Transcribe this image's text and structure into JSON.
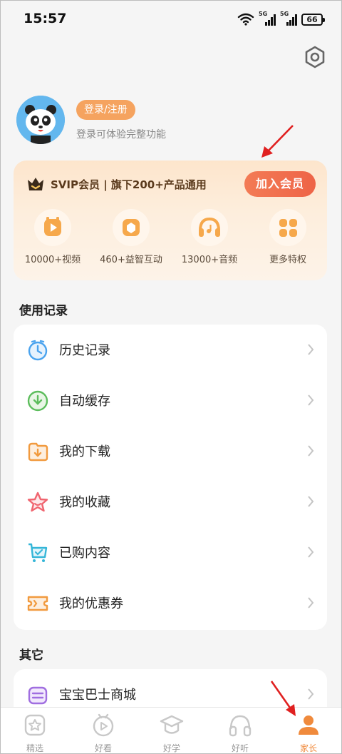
{
  "status_bar": {
    "time": "15:57",
    "network_1": "5G",
    "network_2": "5G",
    "battery": "66"
  },
  "profile": {
    "login_label": "登录/注册",
    "hint": "登录可体验完整功能"
  },
  "vip": {
    "title": "SVIP会员 | 旗下200+产品通用",
    "join_label": "加入会员",
    "perks": [
      {
        "label": "10000+视频",
        "icon": "video-icon"
      },
      {
        "label": "460+益智互动",
        "icon": "puzzle-icon"
      },
      {
        "label": "13000+音频",
        "icon": "headphones-icon"
      },
      {
        "label": "更多特权",
        "icon": "grid-icon"
      }
    ]
  },
  "usage": {
    "title": "使用记录",
    "items": [
      {
        "label": "历史记录",
        "icon": "clock-icon",
        "color": "#4aa3ee"
      },
      {
        "label": "自动缓存",
        "icon": "cache-icon",
        "color": "#5cbd5c"
      },
      {
        "label": "我的下载",
        "icon": "download-icon",
        "color": "#f19a3e"
      },
      {
        "label": "我的收藏",
        "icon": "star-icon",
        "color": "#f0646f"
      },
      {
        "label": "已购内容",
        "icon": "cart-icon",
        "color": "#34b6d8"
      },
      {
        "label": "我的优惠券",
        "icon": "coupon-icon",
        "color": "#f19a3e"
      }
    ]
  },
  "other": {
    "title": "其它",
    "items": [
      {
        "label": "宝宝巴士商城",
        "icon": "shop-icon",
        "color": "#a06ee0"
      }
    ]
  },
  "tabbar": {
    "items": [
      {
        "label": "精选",
        "icon": "star-badge-icon",
        "active": false
      },
      {
        "label": "好看",
        "icon": "tv-icon",
        "active": false
      },
      {
        "label": "好学",
        "icon": "cap-icon",
        "active": false
      },
      {
        "label": "好听",
        "icon": "headphones-icon",
        "active": false
      },
      {
        "label": "家长",
        "icon": "parent-icon",
        "active": true
      }
    ]
  },
  "colors": {
    "accent": "#f08a3c",
    "join_button": "#ee6447",
    "annotation_arrow": "#e02020"
  }
}
